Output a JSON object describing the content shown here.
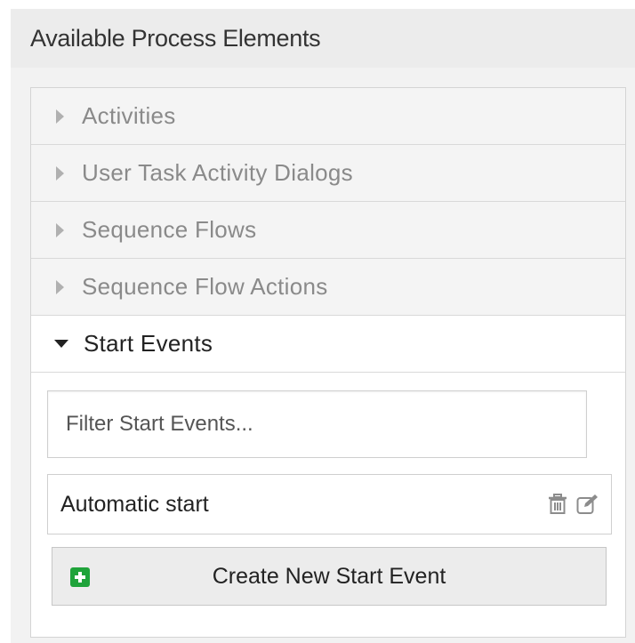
{
  "panel": {
    "title": "Available Process Elements"
  },
  "accordion": {
    "items": [
      {
        "label": "Activities",
        "expanded": false
      },
      {
        "label": "User Task Activity Dialogs",
        "expanded": false
      },
      {
        "label": "Sequence Flows",
        "expanded": false
      },
      {
        "label": "Sequence Flow Actions",
        "expanded": false
      },
      {
        "label": "Start Events",
        "expanded": true
      }
    ]
  },
  "start_events": {
    "filter_placeholder": "Filter Start Events...",
    "filter_value": "",
    "items": [
      {
        "label": "Automatic start",
        "icons": [
          "trash-icon",
          "edit-icon"
        ]
      }
    ],
    "create_button_label": "Create New Start Event",
    "create_button_icon": "plus-square-icon"
  },
  "colors": {
    "accent_green": "#1fa33a",
    "header_bg": "#ececec",
    "inactive_text": "#8a8a8a",
    "active_text": "#222222"
  }
}
